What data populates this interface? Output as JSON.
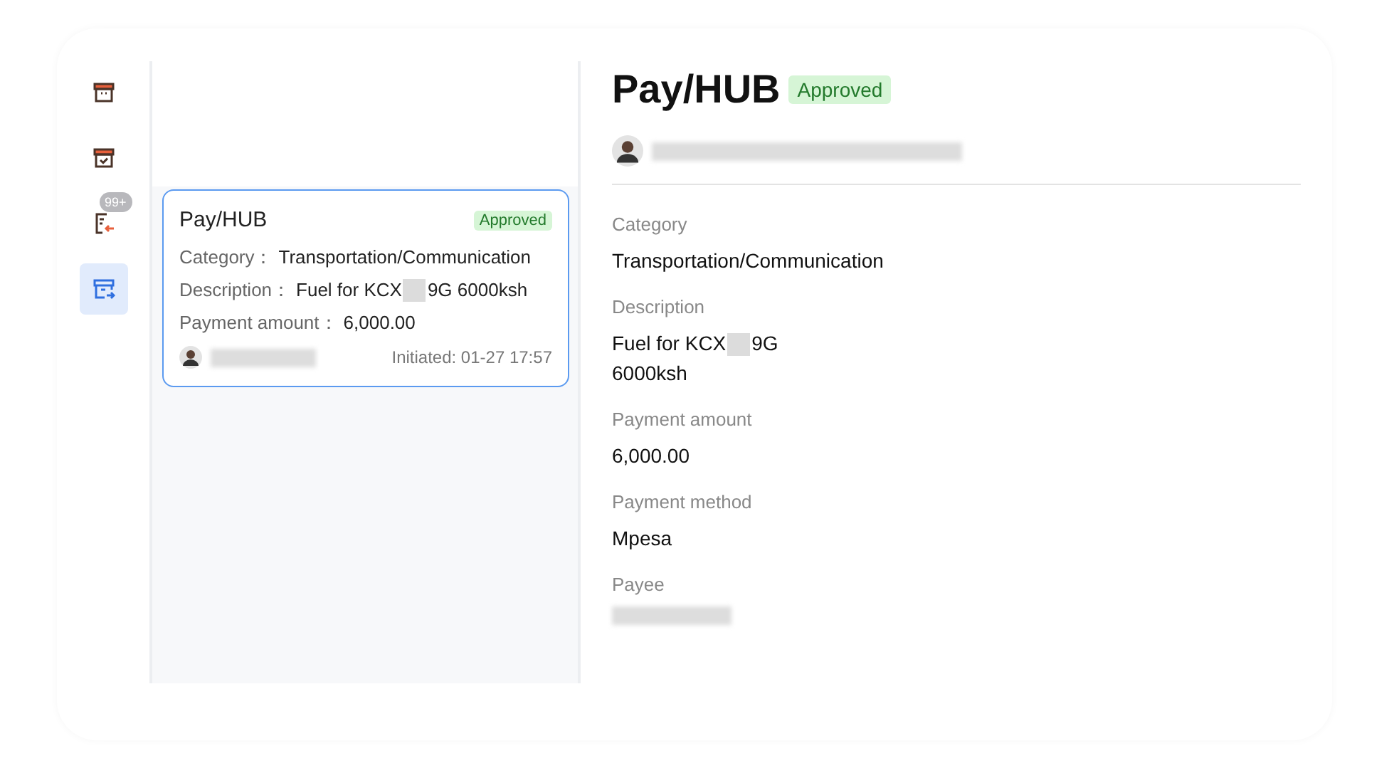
{
  "nav": {
    "items": [
      {
        "kind": "archive",
        "selected": false
      },
      {
        "kind": "archive-check",
        "selected": false
      },
      {
        "kind": "list-in",
        "selected": false,
        "badge": "99+"
      },
      {
        "kind": "archive-out",
        "selected": true
      }
    ]
  },
  "list": {
    "cards": [
      {
        "title": "Pay/HUB",
        "status": {
          "text": "Approved",
          "kind": "approved"
        },
        "selected": true,
        "fields": [
          {
            "label": "Category：",
            "segments": [
              "Transportation/Communication"
            ]
          },
          {
            "label": "Description：",
            "segments": [
              "Fuel for KCX",
              "9G 6000ksh"
            ]
          },
          {
            "label": "Payment amount：",
            "segments": [
              "6,000.00"
            ]
          }
        ],
        "author_redacted": true,
        "initiated": "Initiated: 01-27 17:57"
      }
    ]
  },
  "detail": {
    "title": "Pay/HUB",
    "status": {
      "text": "Approved",
      "kind": "approved"
    },
    "author_redacted": true,
    "fields": [
      {
        "label": "Category",
        "lines": [
          [
            "Transportation/Communication"
          ]
        ]
      },
      {
        "label": "Description",
        "lines": [
          [
            "Fuel for KCX",
            "9G"
          ],
          [
            "6000ksh"
          ]
        ]
      },
      {
        "label": "Payment amount",
        "lines": [
          [
            "6,000.00"
          ]
        ]
      },
      {
        "label": "Payment method",
        "lines": [
          [
            "Mpesa"
          ]
        ]
      },
      {
        "label": "Payee",
        "redacted": true
      }
    ]
  }
}
